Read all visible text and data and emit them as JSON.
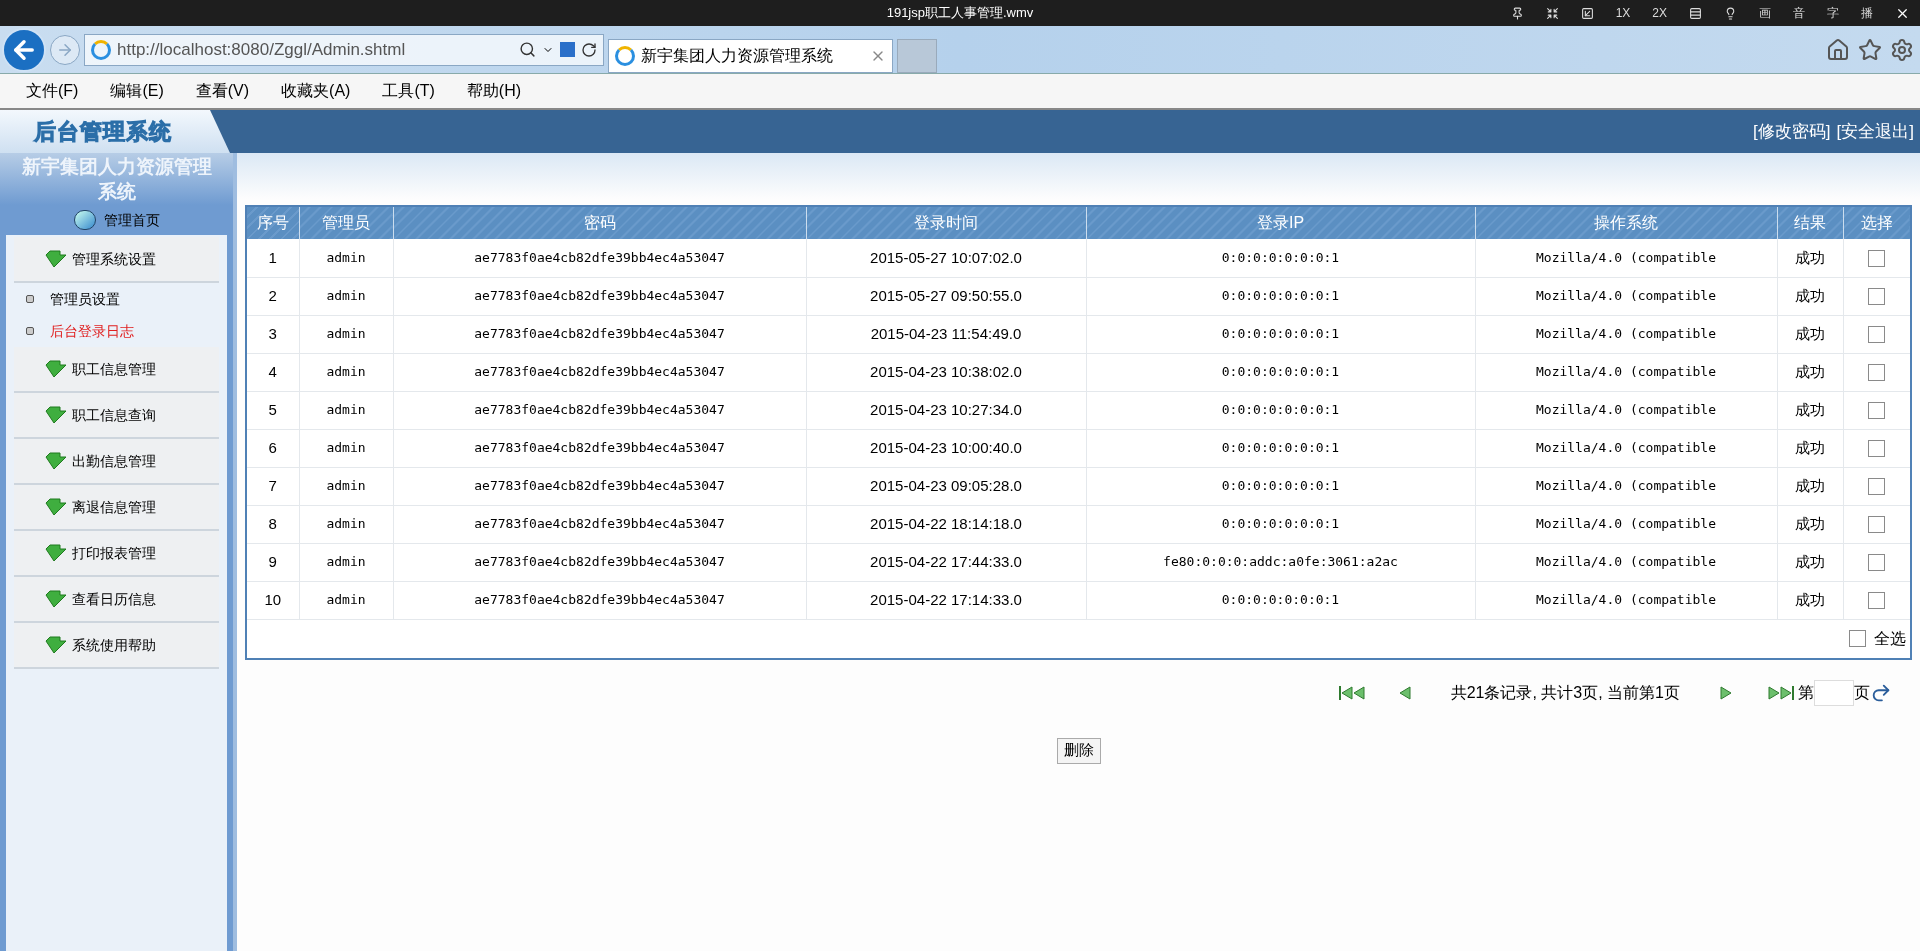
{
  "video_bar": {
    "title": "191jsp职工人事管理.wmv",
    "controls": [
      "1X",
      "2X",
      "画",
      "音",
      "字",
      "播"
    ]
  },
  "browser": {
    "url": "http://localhost:8080/Zggl/Admin.shtml",
    "tab_title": "新宇集团人力资源管理系统",
    "menu": [
      "文件(F)",
      "编辑(E)",
      "查看(V)",
      "收藏夹(A)",
      "工具(T)",
      "帮助(H)"
    ]
  },
  "header": {
    "logo": "后台管理系统",
    "links": [
      "[修改密码]",
      "[安全退出]"
    ]
  },
  "sidebar": {
    "title": "新宇集团人力资源管理系统",
    "home": "管理首页",
    "sections": [
      {
        "label": "管理系统设置",
        "children": [
          {
            "label": "管理员设置",
            "selected": false
          },
          {
            "label": "后台登录日志",
            "selected": true
          }
        ]
      },
      {
        "label": "职工信息管理"
      },
      {
        "label": "职工信息查询"
      },
      {
        "label": "出勤信息管理"
      },
      {
        "label": "离退信息管理"
      },
      {
        "label": "打印报表管理"
      },
      {
        "label": "查看日历信息"
      },
      {
        "label": "系统使用帮助"
      }
    ]
  },
  "table": {
    "columns": [
      "序号",
      "管理员",
      "密码",
      "登录时间",
      "登录IP",
      "操作系统",
      "结果",
      "选择"
    ],
    "rows": [
      {
        "cells": [
          "1",
          "admin",
          "ae7783f0ae4cb82dfe39bb4ec4a53047",
          "2015-05-27 10:07:02.0",
          "0:0:0:0:0:0:0:1",
          "Mozilla/4.0 (compatible",
          "成功"
        ],
        "checked": false
      },
      {
        "cells": [
          "2",
          "admin",
          "ae7783f0ae4cb82dfe39bb4ec4a53047",
          "2015-05-27 09:50:55.0",
          "0:0:0:0:0:0:0:1",
          "Mozilla/4.0 (compatible",
          "成功"
        ],
        "checked": false
      },
      {
        "cells": [
          "3",
          "admin",
          "ae7783f0ae4cb82dfe39bb4ec4a53047",
          "2015-04-23 11:54:49.0",
          "0:0:0:0:0:0:0:1",
          "Mozilla/4.0 (compatible",
          "成功"
        ],
        "checked": false
      },
      {
        "cells": [
          "4",
          "admin",
          "ae7783f0ae4cb82dfe39bb4ec4a53047",
          "2015-04-23 10:38:02.0",
          "0:0:0:0:0:0:0:1",
          "Mozilla/4.0 (compatible",
          "成功"
        ],
        "checked": false
      },
      {
        "cells": [
          "5",
          "admin",
          "ae7783f0ae4cb82dfe39bb4ec4a53047",
          "2015-04-23 10:27:34.0",
          "0:0:0:0:0:0:0:1",
          "Mozilla/4.0 (compatible",
          "成功"
        ],
        "checked": false
      },
      {
        "cells": [
          "6",
          "admin",
          "ae7783f0ae4cb82dfe39bb4ec4a53047",
          "2015-04-23 10:00:40.0",
          "0:0:0:0:0:0:0:1",
          "Mozilla/4.0 (compatible",
          "成功"
        ],
        "checked": false
      },
      {
        "cells": [
          "7",
          "admin",
          "ae7783f0ae4cb82dfe39bb4ec4a53047",
          "2015-04-23 09:05:28.0",
          "0:0:0:0:0:0:0:1",
          "Mozilla/4.0 (compatible",
          "成功"
        ],
        "checked": false
      },
      {
        "cells": [
          "8",
          "admin",
          "ae7783f0ae4cb82dfe39bb4ec4a53047",
          "2015-04-22 18:14:18.0",
          "0:0:0:0:0:0:0:1",
          "Mozilla/4.0 (compatible",
          "成功"
        ],
        "checked": false
      },
      {
        "cells": [
          "9",
          "admin",
          "ae7783f0ae4cb82dfe39bb4ec4a53047",
          "2015-04-22 17:44:33.0",
          "fe80:0:0:0:addc:a0fe:3061:a2ac",
          "Mozilla/4.0 (compatible",
          "成功"
        ],
        "checked": false
      },
      {
        "cells": [
          "10",
          "admin",
          "ae7783f0ae4cb82dfe39bb4ec4a53047",
          "2015-04-22 17:14:33.0",
          "0:0:0:0:0:0:0:1",
          "Mozilla/4.0 (compatible",
          "成功"
        ],
        "checked": false
      }
    ],
    "select_all": {
      "label": "全选",
      "checked": false
    }
  },
  "pager": {
    "summary": "共21条记录, 共计3页, 当前第1页",
    "page_prefix": "第",
    "page_suffix": "页"
  },
  "delete_button": "删除"
}
